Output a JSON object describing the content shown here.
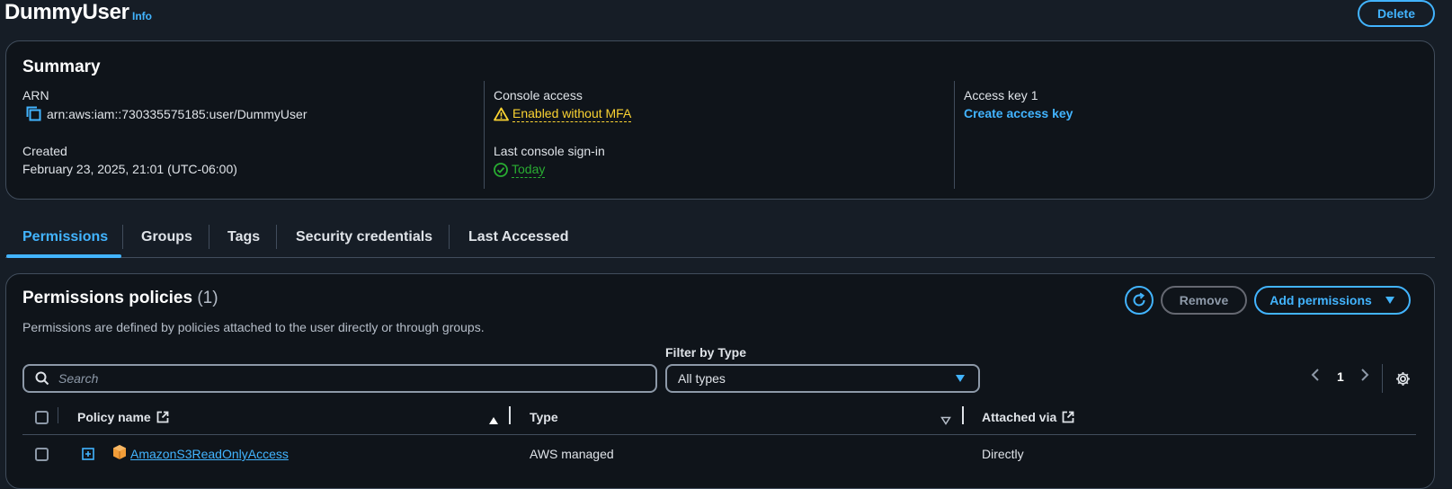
{
  "header": {
    "title": "DummyUser",
    "info_label": "Info",
    "delete_label": "Delete"
  },
  "summary": {
    "title": "Summary",
    "arn_label": "ARN",
    "arn_value": "arn:aws:iam::730335575185:user/DummyUser",
    "created_label": "Created",
    "created_value": "February 23, 2025, 21:01 (UTC-06:00)",
    "console_access_label": "Console access",
    "console_access_value": "Enabled without MFA",
    "last_signin_label": "Last console sign-in",
    "last_signin_value": "Today",
    "access_key_label": "Access key 1",
    "access_key_action": "Create access key"
  },
  "tabs": [
    {
      "label": "Permissions",
      "active": true
    },
    {
      "label": "Groups",
      "active": false
    },
    {
      "label": "Tags",
      "active": false
    },
    {
      "label": "Security credentials",
      "active": false
    },
    {
      "label": "Last Accessed",
      "active": false
    }
  ],
  "permissions": {
    "title": "Permissions policies",
    "count": "(1)",
    "description": "Permissions are defined by policies attached to the user directly or through groups.",
    "remove_label": "Remove",
    "add_label": "Add permissions",
    "filter_label": "Filter by Type",
    "search_placeholder": "Search",
    "filter_value": "All types",
    "page": "1",
    "columns": [
      "Policy name",
      "Type",
      "Attached via"
    ],
    "rows": [
      {
        "policy_name": "AmazonS3ReadOnlyAccess",
        "type": "AWS managed",
        "attached_via": "Directly"
      }
    ]
  },
  "colors": {
    "accent": "#42b4ff",
    "warning": "#fbd332",
    "success": "#29ad32",
    "background": "#161d26",
    "card": "#0f141a",
    "border": "#414d5c"
  },
  "icons": [
    "copy-icon",
    "warning-icon",
    "check-circle-icon",
    "refresh-icon",
    "caret-down-icon",
    "search-icon",
    "chevron-left-icon",
    "chevron-right-icon",
    "settings-icon",
    "external-link-icon",
    "sort-asc-icon",
    "sort-desc-icon",
    "expand-icon",
    "aws-policy-icon"
  ]
}
